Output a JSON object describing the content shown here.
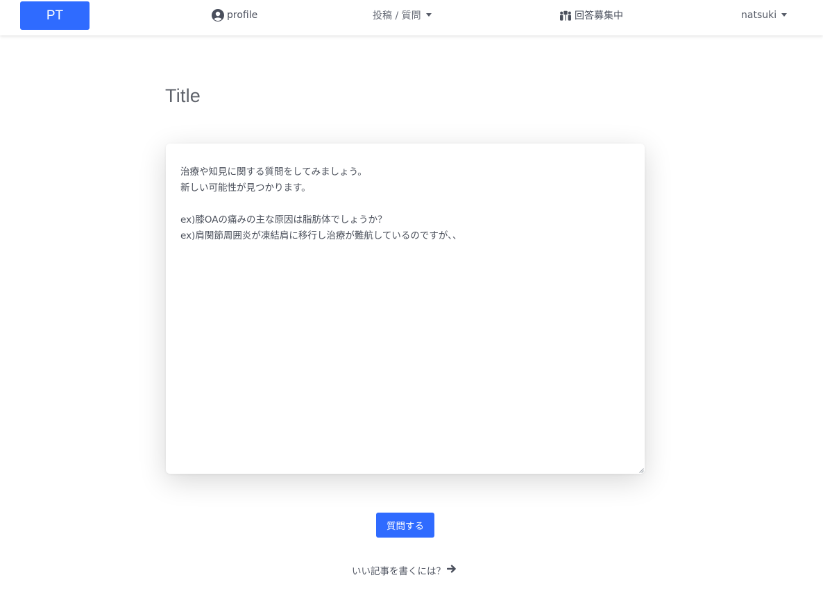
{
  "navbar": {
    "brand": "PT",
    "profile_label": "profile",
    "post_label": "投稿 / 質問",
    "open_label": "回答募集中",
    "user_label": "natsuki"
  },
  "page": {
    "title": "Title"
  },
  "editor": {
    "lines": [
      "治療や知見に関する質問をしてみましょう。",
      "新しい可能性が見つかります。",
      "",
      "ex)膝OAの痛みの主な原因は脂肪体でしょうか？",
      "ex)肩関節周囲炎が凍結肩に移行し治療が難航しているのですが、、"
    ]
  },
  "actions": {
    "submit_label": "質問する",
    "guide_label": "いい記事を書くには？"
  },
  "icons": {
    "profile": "user-circle-icon",
    "post_caret": "chevron-down-icon",
    "open": "people-help-icon",
    "user_caret": "chevron-down-icon",
    "guide": "arrow-right-icon",
    "resize": "resize-grip-icon"
  },
  "colors": {
    "brand": "#2f6bff",
    "text": "#4a4f5c",
    "title": "#5f636b"
  }
}
